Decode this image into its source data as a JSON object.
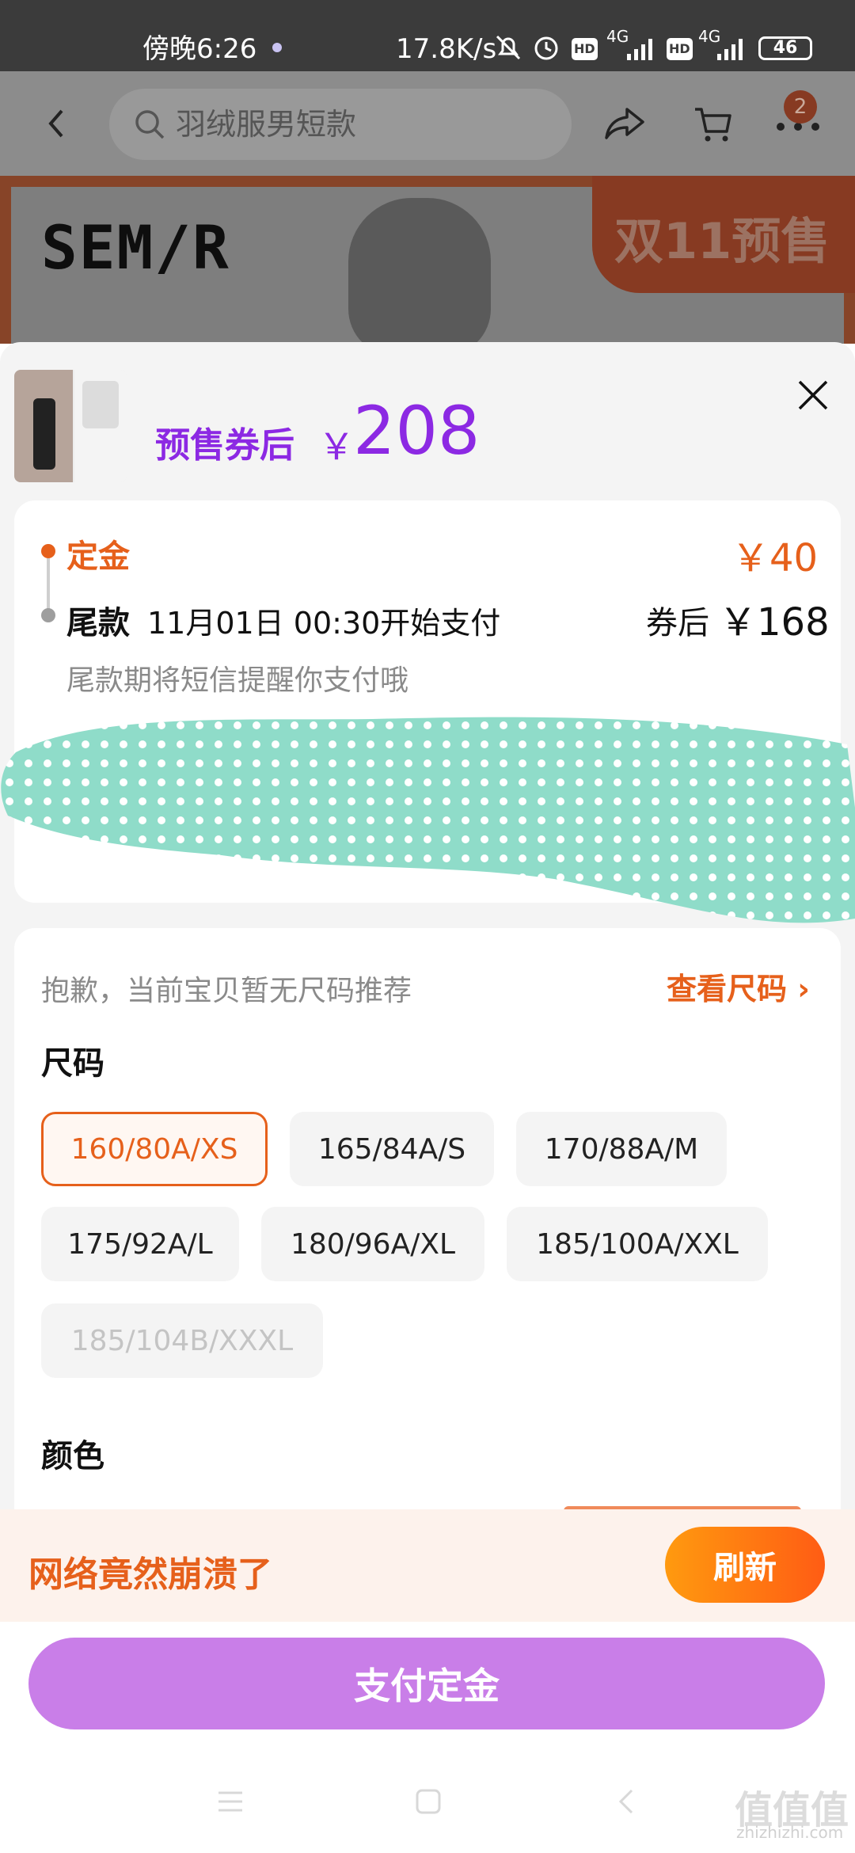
{
  "status_bar": {
    "time": "傍晚6:26",
    "net_speed": "17.8K/s",
    "signal1": "4G",
    "signal2": "4G",
    "battery": "46"
  },
  "header": {
    "search_placeholder": "羽绒服男短款",
    "cart_badge": "2"
  },
  "banner": {
    "brand": "SEM/R",
    "badge": "双11预售"
  },
  "product": {
    "price_label": "预售券后",
    "currency": "￥",
    "price": "208"
  },
  "payment": {
    "deposit_label": "定金",
    "deposit_amount": "￥40",
    "balance_label": "尾款",
    "balance_time": "11月01日 00:30开始支付",
    "after_coupon": "券后",
    "balance_amount": "￥168",
    "sms_note": "尾款期将短信提醒你支付哦"
  },
  "sizes": {
    "no_recommend": "抱歉，当前宝贝暂无尺码推荐",
    "chart_link": "查看尺码",
    "title": "尺码",
    "options": [
      "160/80A/XS",
      "165/84A/S",
      "170/88A/M",
      "175/92A/L",
      "180/96A/XL",
      "185/100A/XXL",
      "185/104B/XXXL"
    ],
    "selected": "160/80A/XS",
    "disabled": "185/104B/XXXL"
  },
  "color": {
    "title": "颜色"
  },
  "network": {
    "message": "网络竟然崩溃了",
    "refresh": "刷新"
  },
  "footer": {
    "pay_button": "支付定金",
    "watermark": "值值值",
    "watermark_sub": "zhizhizhi.com"
  },
  "colors": {
    "accent_orange": "#e6601b",
    "price_purple": "#8c29e3",
    "pay_button": "#c97ee8",
    "censor_teal": "#8fdcc9"
  }
}
